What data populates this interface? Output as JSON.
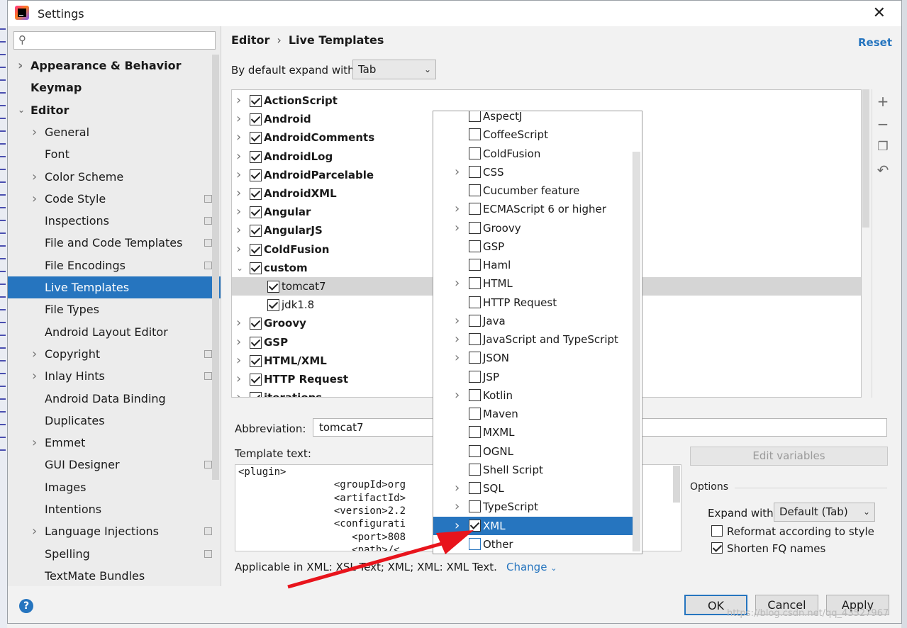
{
  "window": {
    "title": "Settings"
  },
  "search": {
    "value": ""
  },
  "sidebar": {
    "items": [
      {
        "label": "Appearance & Behavior",
        "expandable": true,
        "bold": true
      },
      {
        "label": "Keymap",
        "expandable": false,
        "bold": true
      },
      {
        "label": "Editor",
        "expandable": true,
        "expanded": true,
        "bold": true
      },
      {
        "label": "General",
        "expandable": true
      },
      {
        "label": "Font",
        "expandable": false
      },
      {
        "label": "Color Scheme",
        "expandable": true
      },
      {
        "label": "Code Style",
        "expandable": true,
        "project": true
      },
      {
        "label": "Inspections",
        "expandable": false,
        "project": true
      },
      {
        "label": "File and Code Templates",
        "expandable": false,
        "project": true
      },
      {
        "label": "File Encodings",
        "expandable": false,
        "project": true
      },
      {
        "label": "Live Templates",
        "expandable": false,
        "selected": true
      },
      {
        "label": "File Types",
        "expandable": false
      },
      {
        "label": "Android Layout Editor",
        "expandable": false
      },
      {
        "label": "Copyright",
        "expandable": true,
        "project": true
      },
      {
        "label": "Inlay Hints",
        "expandable": true,
        "project": true
      },
      {
        "label": "Android Data Binding",
        "expandable": false
      },
      {
        "label": "Duplicates",
        "expandable": false
      },
      {
        "label": "Emmet",
        "expandable": true
      },
      {
        "label": "GUI Designer",
        "expandable": false,
        "project": true
      },
      {
        "label": "Images",
        "expandable": false
      },
      {
        "label": "Intentions",
        "expandable": false
      },
      {
        "label": "Language Injections",
        "expandable": true,
        "project": true
      },
      {
        "label": "Spelling",
        "expandable": false,
        "project": true
      },
      {
        "label": "TextMate Bundles",
        "expandable": false
      }
    ]
  },
  "header": {
    "breadcrumb_root": "Editor",
    "breadcrumb_sep": "›",
    "breadcrumb_page": "Live Templates",
    "reset": "Reset"
  },
  "expand": {
    "label": "By default expand with",
    "value": "Tab"
  },
  "template_groups": [
    {
      "label": "ActionScript",
      "checked": true,
      "group": true
    },
    {
      "label": "Android",
      "checked": true,
      "group": true
    },
    {
      "label": "AndroidComments",
      "checked": true,
      "group": true
    },
    {
      "label": "AndroidLog",
      "checked": true,
      "group": true
    },
    {
      "label": "AndroidParcelable",
      "checked": true,
      "group": true
    },
    {
      "label": "AndroidXML",
      "checked": true,
      "group": true
    },
    {
      "label": "Angular",
      "checked": true,
      "group": true
    },
    {
      "label": "AngularJS",
      "checked": true,
      "group": true
    },
    {
      "label": "ColdFusion",
      "checked": true,
      "group": true
    },
    {
      "label": "custom",
      "checked": true,
      "group": true,
      "expanded": true
    },
    {
      "label": "tomcat7",
      "checked": true,
      "group": false,
      "selected": true
    },
    {
      "label": "jdk1.8",
      "checked": true,
      "group": false
    },
    {
      "label": "Groovy",
      "checked": true,
      "group": true
    },
    {
      "label": "GSP",
      "checked": true,
      "group": true
    },
    {
      "label": "HTML/XML",
      "checked": true,
      "group": true
    },
    {
      "label": "HTTP Request",
      "checked": true,
      "group": true
    },
    {
      "label": "iterations",
      "checked": true,
      "group": true
    }
  ],
  "tools": {
    "add": "+",
    "remove": "−",
    "copy": "❐",
    "restore": "↶"
  },
  "abbreviation": {
    "label": "Abbreviation:",
    "value": "tomcat7"
  },
  "template_text": {
    "label": "Template text:",
    "lines": [
      "<plugin>",
      "                <groupId>org",
      "                <artifactId>",
      "                <version>2.2",
      "                <configurati",
      "                   <port>808",
      "                   <path>/<"
    ]
  },
  "edit_variables": "Edit variables",
  "options": {
    "title": "Options",
    "expand_label": "Expand with",
    "expand_value": "Default (Tab)",
    "reformat": {
      "label": "Reformat according to style",
      "checked": false
    },
    "shorten": {
      "label": "Shorten FQ names",
      "checked": true
    }
  },
  "applicable": {
    "text": "Applicable in XML: XSL Text; XML; XML: XML Text.",
    "change": "Change"
  },
  "buttons": {
    "ok": "OK",
    "cancel": "Cancel",
    "apply": "Apply",
    "help": "?"
  },
  "popup": {
    "items": [
      {
        "label": "AspectJ",
        "expandable": false,
        "checked": false
      },
      {
        "label": "CoffeeScript",
        "expandable": false,
        "checked": false
      },
      {
        "label": "ColdFusion",
        "expandable": false,
        "checked": false
      },
      {
        "label": "CSS",
        "expandable": true,
        "checked": false
      },
      {
        "label": "Cucumber feature",
        "expandable": false,
        "checked": false
      },
      {
        "label": "ECMAScript 6 or higher",
        "expandable": true,
        "checked": false
      },
      {
        "label": "Groovy",
        "expandable": true,
        "checked": false
      },
      {
        "label": "GSP",
        "expandable": false,
        "checked": false
      },
      {
        "label": "Haml",
        "expandable": false,
        "checked": false
      },
      {
        "label": "HTML",
        "expandable": true,
        "checked": false
      },
      {
        "label": "HTTP Request",
        "expandable": false,
        "checked": false
      },
      {
        "label": "Java",
        "expandable": true,
        "checked": false
      },
      {
        "label": "JavaScript and TypeScript",
        "expandable": true,
        "checked": false
      },
      {
        "label": "JSON",
        "expandable": true,
        "checked": false
      },
      {
        "label": "JSP",
        "expandable": false,
        "checked": false
      },
      {
        "label": "Kotlin",
        "expandable": true,
        "checked": false
      },
      {
        "label": "Maven",
        "expandable": false,
        "checked": false
      },
      {
        "label": "MXML",
        "expandable": false,
        "checked": false
      },
      {
        "label": "OGNL",
        "expandable": false,
        "checked": false
      },
      {
        "label": "Shell Script",
        "expandable": false,
        "checked": false
      },
      {
        "label": "SQL",
        "expandable": true,
        "checked": false
      },
      {
        "label": "TypeScript",
        "expandable": true,
        "checked": false
      },
      {
        "label": "XML",
        "expandable": true,
        "checked": true,
        "selected": true
      },
      {
        "label": "Other",
        "expandable": false,
        "checked": false,
        "focused": true
      }
    ]
  },
  "watermark": "https://blog.csdn.net/qq_43527967",
  "colors": {
    "accent": "#2675bf",
    "annotation_arrow": "#e8141c"
  }
}
